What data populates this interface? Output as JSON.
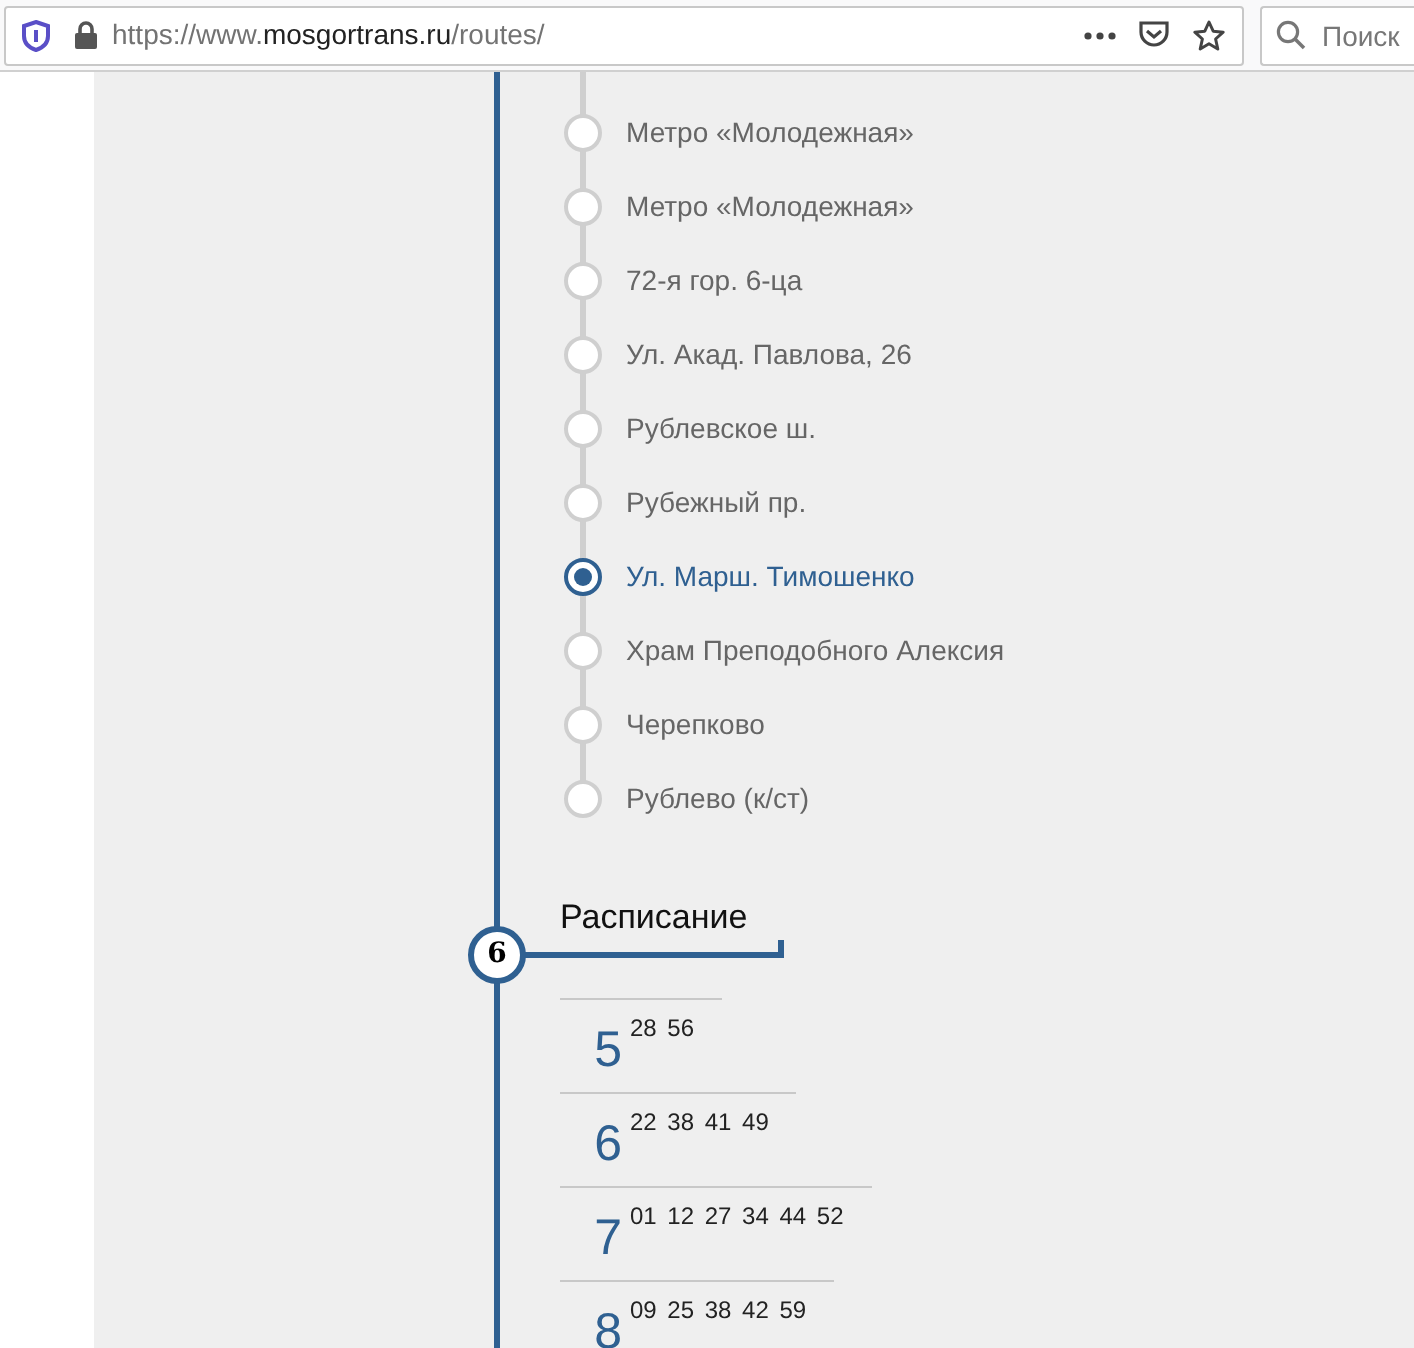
{
  "browser": {
    "url_prefix": "https://www.",
    "url_domain": "mosgortrans.ru",
    "url_path": "/routes/",
    "search_placeholder": "Поиск"
  },
  "stops": [
    {
      "name": "Метро «Молодежная»",
      "selected": false
    },
    {
      "name": "Метро «Молодежная»",
      "selected": false
    },
    {
      "name": "72-я гор. 6-ца",
      "selected": false
    },
    {
      "name": "Ул. Акад. Павлова, 26",
      "selected": false
    },
    {
      "name": "Рублевское ш.",
      "selected": false
    },
    {
      "name": "Рубежный пр.",
      "selected": false
    },
    {
      "name": "Ул. Марш. Тимошенко",
      "selected": true
    },
    {
      "name": "Храм Преподобного Алексия",
      "selected": false
    },
    {
      "name": "Черепково",
      "selected": false
    },
    {
      "name": "Рублево (к/ст)",
      "selected": false
    }
  ],
  "schedule": {
    "step": "6",
    "title": "Расписание",
    "rows": [
      {
        "hour": "5",
        "minutes": "28 56"
      },
      {
        "hour": "6",
        "minutes": "22 38 41 49"
      },
      {
        "hour": "7",
        "minutes": "01 12 27 34 44 52"
      },
      {
        "hour": "8",
        "minutes": "09 25 38 42 59"
      }
    ]
  }
}
